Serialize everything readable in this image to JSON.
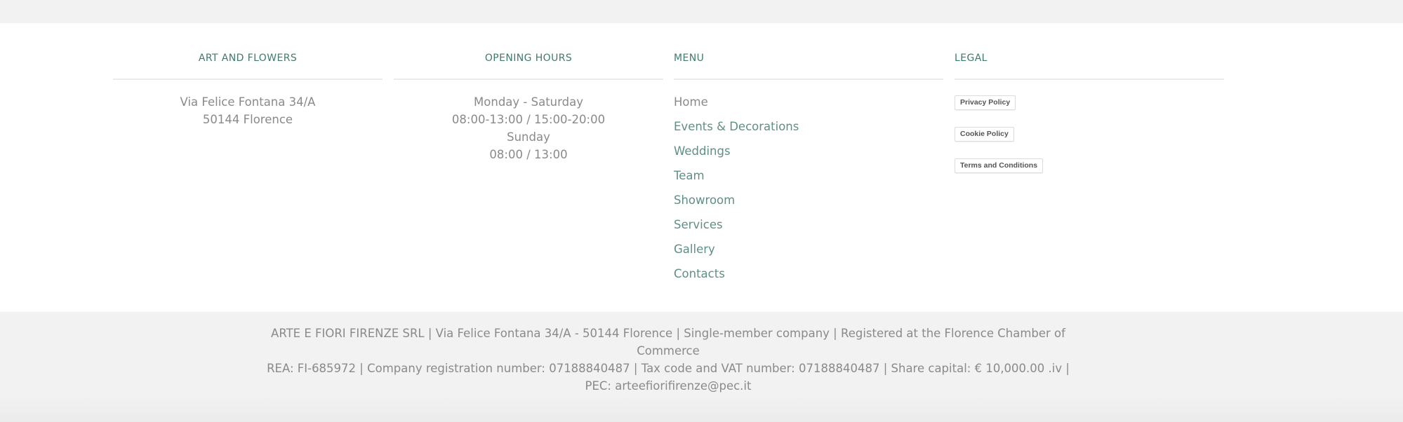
{
  "columns": {
    "art_and_flowers": {
      "heading": "ART AND FLOWERS",
      "lines": [
        "Via Felice Fontana 34/A",
        "50144 Florence"
      ]
    },
    "opening_hours": {
      "heading": "OPENING HOURS",
      "lines": [
        "Monday - Saturday",
        "08:00-13:00 / 15:00-20:00",
        "Sunday",
        "08:00 / 13:00"
      ]
    },
    "menu": {
      "heading": "MENU",
      "items": [
        {
          "label": "Home"
        },
        {
          "label": "Events & Decorations"
        },
        {
          "label": "Weddings"
        },
        {
          "label": "Team"
        },
        {
          "label": "Showroom"
        },
        {
          "label": "Services"
        },
        {
          "label": "Gallery"
        },
        {
          "label": "Contacts"
        }
      ]
    },
    "legal": {
      "heading": "LEGAL",
      "buttons": [
        {
          "label": "Privacy Policy"
        },
        {
          "label": "Cookie Policy"
        },
        {
          "label": "Terms and Conditions"
        }
      ]
    }
  },
  "bottom_bar": {
    "line1": "ARTE E FIORI FIRENZE SRL | Via Felice Fontana 34/A - 50144 Florence | Single-member company | Registered at the Florence Chamber of Commerce",
    "line2": "REA: FI-685972 | Company registration number: 07188840487 | Tax code and VAT number: 07188840487 | Share capital: € 10,000.00 .iv | PEC: arteefiorifirenze@pec.it"
  },
  "colors": {
    "accent": "#3f7a6f",
    "link": "#5f8f86",
    "text": "#8a8a8a",
    "bottom_bar_bg": "#f2f2f2"
  }
}
